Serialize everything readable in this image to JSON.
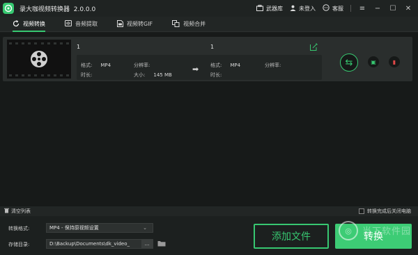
{
  "app": {
    "title": "录大咖视频转换器",
    "version": "2.0.0.0"
  },
  "titlebar": {
    "toolbox": "武器库",
    "login": "未登入",
    "support": "客服"
  },
  "tabs": [
    {
      "label": "视频转换",
      "icon": "convert-cycle-icon",
      "active": true
    },
    {
      "label": "音频提取",
      "icon": "audio-icon",
      "active": false
    },
    {
      "label": "视频转GIF",
      "icon": "gif-file-icon",
      "active": false
    },
    {
      "label": "视频合并",
      "icon": "merge-icon",
      "active": false
    }
  ],
  "item": {
    "source": {
      "name": "1",
      "format_label": "格式:",
      "format": "MP4",
      "resolution_label": "分辨率:",
      "resolution": "",
      "duration_label": "时长:",
      "duration": "",
      "size_label": "大小:",
      "size": "145 MB"
    },
    "output": {
      "name": "1",
      "format_label": "格式:",
      "format": "MP4",
      "resolution_label": "分辨率:",
      "resolution": "",
      "duration_label": "时长:",
      "duration": ""
    }
  },
  "bottom": {
    "clear_list": "清空列表",
    "shutdown": "转换完成后关闭电脑"
  },
  "footer": {
    "format_label": "转换格式:",
    "format_value": "MP4 - 保持原视频设置",
    "dir_label": "存储目录:",
    "dir_value": "D:\\Backup\\Documents\\dk_video_",
    "dir_more": "...",
    "add_file": "添加文件",
    "convert": "转换"
  },
  "watermark": "当下软件园",
  "colors": {
    "accent": "#37c871",
    "danger": "#e04848",
    "background": "#1b1e1d"
  }
}
